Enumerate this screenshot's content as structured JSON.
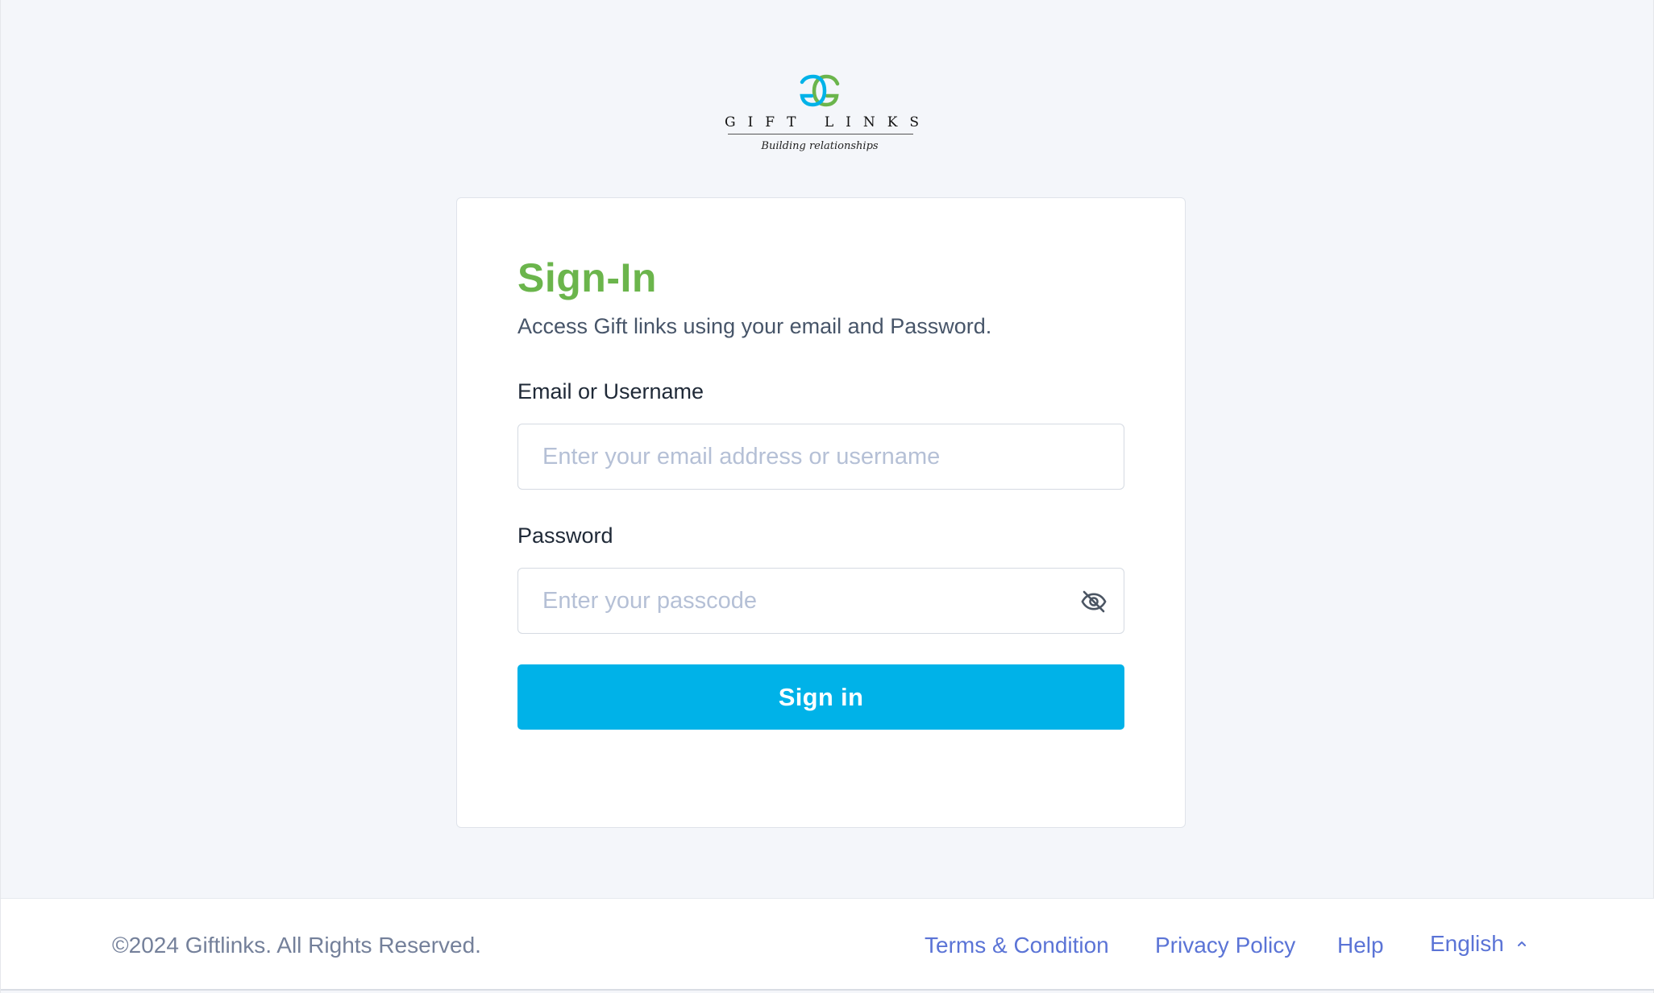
{
  "brand": {
    "name": "GIFT LINKS",
    "tagline": "Building relationships",
    "colors": {
      "logo_blue": "#00b2e8",
      "logo_green": "#6bb54c"
    }
  },
  "signin": {
    "title": "Sign-In",
    "subtitle": "Access Gift links using your email and Password.",
    "email_label": "Email or Username",
    "email_placeholder": "Enter your email address or username",
    "email_value": "",
    "password_label": "Password",
    "password_placeholder": "Enter your passcode",
    "password_value": "",
    "password_toggle_icon": "eye-off-icon",
    "submit_label": "Sign in",
    "colors": {
      "title": "#6bb54c",
      "button": "#00b2e8"
    }
  },
  "footer": {
    "copyright": "©2024 Giftlinks. All Rights Reserved.",
    "links": {
      "terms": "Terms & Condition",
      "privacy": "Privacy Policy",
      "help": "Help"
    },
    "language": {
      "selected": "English",
      "icon": "chevron-up-icon"
    },
    "colors": {
      "link": "#5b74d6",
      "muted": "#74809a"
    }
  }
}
